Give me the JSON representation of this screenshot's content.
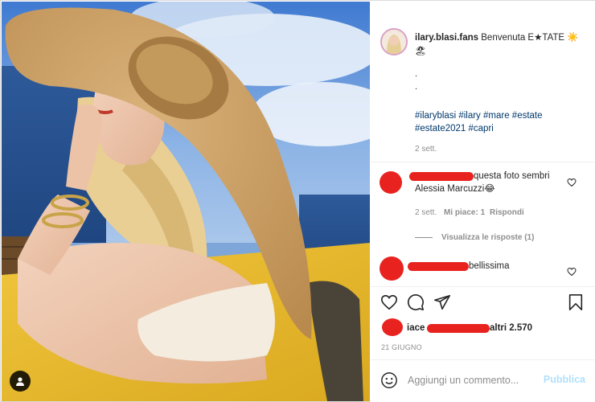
{
  "post": {
    "username": "ilary.blasi.fans",
    "caption_text": "Benvenuta E★TATE ☀️ 🏖",
    "dots": [
      ".",
      "."
    ],
    "hashtags_line1": "#ilaryblasi #ilary #mare #estate",
    "hashtags_line2": "#estate2021 #capri",
    "age": "2 sett."
  },
  "comments": [
    {
      "text_after_name": "questa foto sembri",
      "text_line2": "Alessia Marcuzzi😂",
      "age": "2 sett.",
      "likes": "Mi piace: 1",
      "reply": "Rispondi",
      "view_replies": "Visualizza le risposte (1)"
    },
    {
      "text_after_name": "bellissima"
    }
  ],
  "likes": {
    "prefix": "iace",
    "suffix": "altri 2.570"
  },
  "date": "21 GIUGNO",
  "add_comment": {
    "placeholder": "Aggiungi un commento...",
    "publish_label": "Pubblica"
  },
  "icons": {
    "heart": "heart-icon",
    "comment": "comment-icon",
    "share": "share-icon",
    "save": "bookmark-icon",
    "emoji": "emoji-icon",
    "user_tag": "user-tag-icon"
  },
  "colors": {
    "link_blue": "#00376b",
    "meta_gray": "#8e8e8e",
    "publish_disabled": "#b2dffc",
    "redaction_red": "#e8231f"
  }
}
